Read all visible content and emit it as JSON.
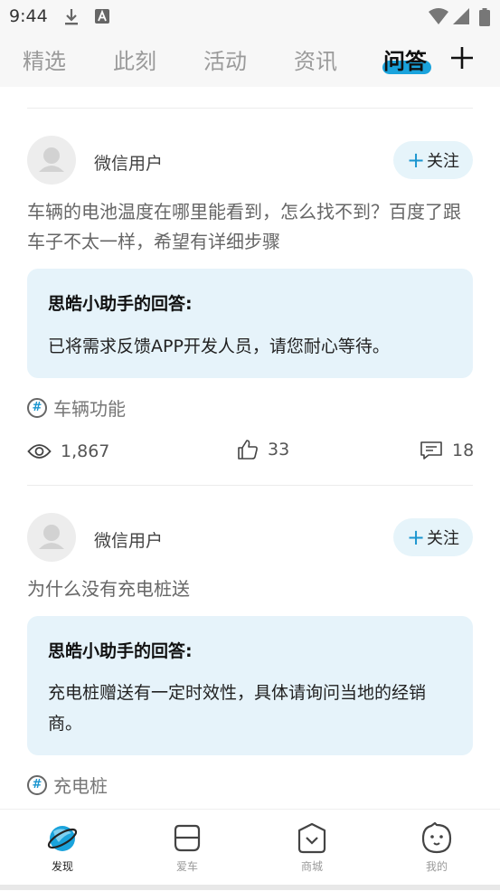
{
  "status_bar": {
    "time": "9:44"
  },
  "tabs": [
    {
      "label": "精选",
      "active": false
    },
    {
      "label": "此刻",
      "active": false
    },
    {
      "label": "活动",
      "active": false
    },
    {
      "label": "资讯",
      "active": false
    },
    {
      "label": "问答",
      "active": true
    }
  ],
  "accent_color": "#1aa3dc",
  "posts": [
    {
      "username": "微信用户",
      "follow_label": "关注",
      "question": "车辆的电池温度在哪里能看到，怎么找不到？百度了跟车子不太一样，希望有详细步骤",
      "answer_title": "思皓小助手的回答:",
      "answer_text": "已将需求反馈APP开发人员，请您耐心等待。",
      "topic": "车辆功能",
      "views": "1,867",
      "likes": "33",
      "comments": "18"
    },
    {
      "username": "微信用户",
      "follow_label": "关注",
      "question": "为什么没有充电桩送",
      "answer_title": "思皓小助手的回答:",
      "answer_text": "充电桩赠送有一定时效性，具体请询问当地的经销商。",
      "topic": "充电桩"
    }
  ],
  "bottom_nav": [
    {
      "label": "发现",
      "icon": "planet-icon",
      "active": true
    },
    {
      "label": "爱车",
      "icon": "car-icon",
      "active": false
    },
    {
      "label": "商城",
      "icon": "shop-icon",
      "active": false
    },
    {
      "label": "我的",
      "icon": "smiley-icon",
      "active": false
    }
  ]
}
